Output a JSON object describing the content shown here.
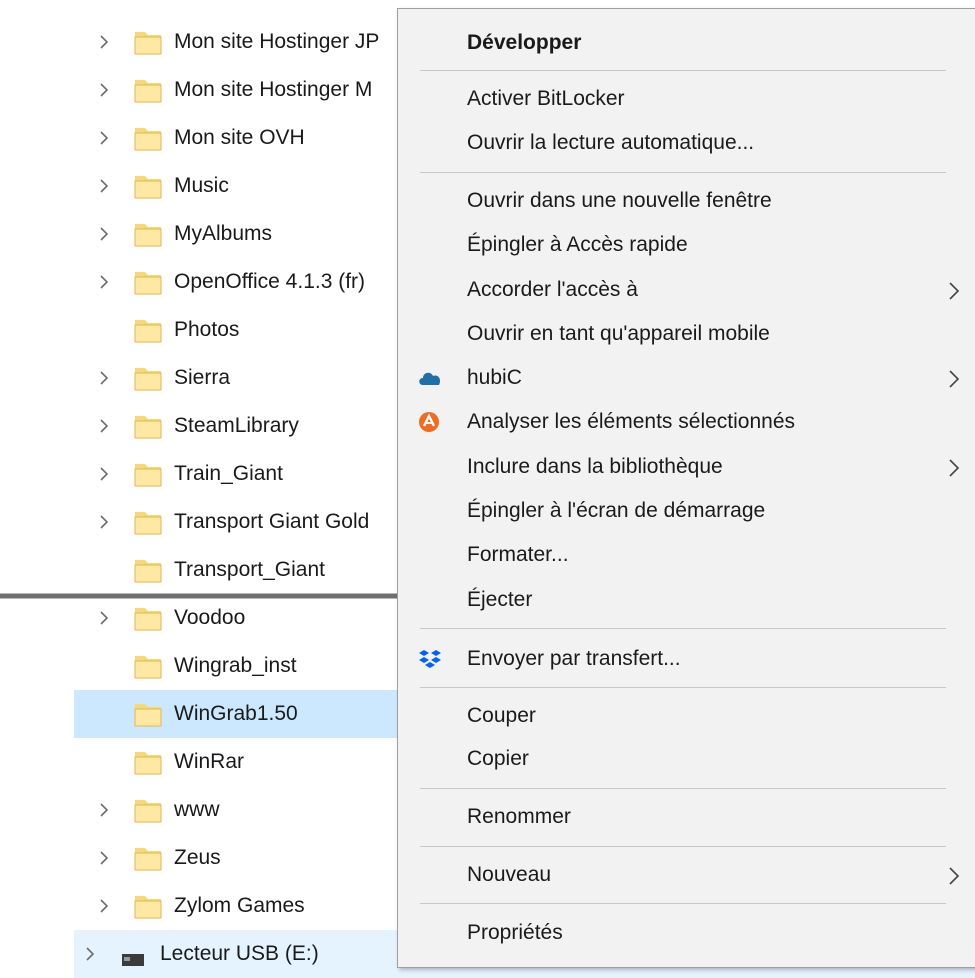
{
  "tree": {
    "items": [
      {
        "label": "Mon site Hostinger JP",
        "expandable": true
      },
      {
        "label": "Mon site Hostinger M",
        "expandable": true
      },
      {
        "label": "Mon site OVH",
        "expandable": true
      },
      {
        "label": "Music",
        "expandable": true
      },
      {
        "label": "MyAlbums",
        "expandable": true
      },
      {
        "label": "OpenOffice 4.1.3 (fr)",
        "expandable": true
      },
      {
        "label": "Photos",
        "expandable": false
      },
      {
        "label": "Sierra",
        "expandable": true
      },
      {
        "label": "SteamLibrary",
        "expandable": true
      },
      {
        "label": "Train_Giant",
        "expandable": true
      },
      {
        "label": "Transport Giant Gold",
        "expandable": true
      },
      {
        "label": "Transport_Giant",
        "expandable": false
      },
      {
        "label": "Voodoo",
        "expandable": true
      },
      {
        "label": "Wingrab_inst",
        "expandable": false
      },
      {
        "label": "WinGrab1.50",
        "expandable": false,
        "selected": true
      },
      {
        "label": "WinRar",
        "expandable": false
      },
      {
        "label": "www",
        "expandable": true
      },
      {
        "label": "Zeus",
        "expandable": true
      },
      {
        "label": "Zylom Games",
        "expandable": true
      }
    ],
    "drive": {
      "label": "Lecteur USB (E:)"
    }
  },
  "menu": {
    "items": [
      {
        "label": "Développer",
        "bold": true
      },
      {
        "label": "Activer BitLocker"
      },
      {
        "label": "Ouvrir la lecture automatique..."
      },
      {
        "label": "Ouvrir dans une nouvelle fenêtre"
      },
      {
        "label": "Épingler à Accès rapide"
      },
      {
        "label": "Accorder l'accès à",
        "submenu": true
      },
      {
        "label": "Ouvrir en tant qu'appareil mobile"
      },
      {
        "label": "hubiC",
        "submenu": true,
        "icon": "cloud-icon"
      },
      {
        "label": "Analyser les éléments sélectionnés",
        "icon": "avast-icon"
      },
      {
        "label": "Inclure dans la bibliothèque",
        "submenu": true
      },
      {
        "label": "Épingler à l'écran de démarrage"
      },
      {
        "label": "Formater..."
      },
      {
        "label": "Éjecter"
      },
      {
        "label": "Envoyer par transfert...",
        "icon": "dropbox-icon"
      },
      {
        "label": "Couper"
      },
      {
        "label": "Copier"
      },
      {
        "label": "Renommer"
      },
      {
        "label": "Nouveau",
        "submenu": true
      },
      {
        "label": "Propriétés"
      }
    ]
  },
  "colors": {
    "selection": "#cce8ff",
    "folder": "#f8d775",
    "menu_bg": "#f2f2f2",
    "arrow": "#707070",
    "hubic": "#1f6fa8",
    "avast": "#f26b21",
    "dropbox": "#0061fe"
  }
}
